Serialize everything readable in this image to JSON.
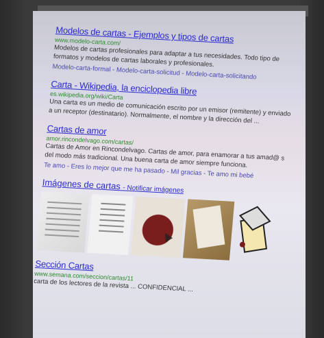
{
  "results": [
    {
      "title": "Modelos de cartas - Ejemplos y tipos de cartas",
      "url": "www.modelo-carta.com/",
      "snippet": "Modelos de cartas profesionales para adaptar a tus necesidades. Todo tipo de formatos y modelos de cartas laborales y profesionales.",
      "sitelinks": "Modelo-carta-formal - Modelo-carta-solicitud - Modelo-carta-solicitando"
    },
    {
      "title": "Carta - Wikipedia, la enciclopedia libre",
      "url": "es.wikipedia.org/wiki/Carta",
      "snippet": "Una carta es un medio de comunicación escrito por un emisor (remitente) y enviado a un receptor (destinatario). Normalmente, el nombre y la dirección del ..."
    },
    {
      "title": "Cartas de amor",
      "url": "amor.rincondelvago.com/cartas/",
      "snippet": "Cartas de Amor en Rincondelvago. Cartas de amor, para enamorar a tus amad@ s del modo más tradicional. Una buena carta de amor siempre funciona.",
      "sitelinks": "Te amo - Eres lo mejor que me ha pasado - Mil gracias - Te amo mi bebé"
    }
  ],
  "images": {
    "title": "Imágenes de cartas",
    "notify": "- Notificar imágenes"
  },
  "last_result": {
    "title": "Sección Cartas",
    "url": "www.semana.com/seccion/cartas/11",
    "snippet": "carta de los lectores de la revista ... CONFIDENCIAL ..."
  }
}
